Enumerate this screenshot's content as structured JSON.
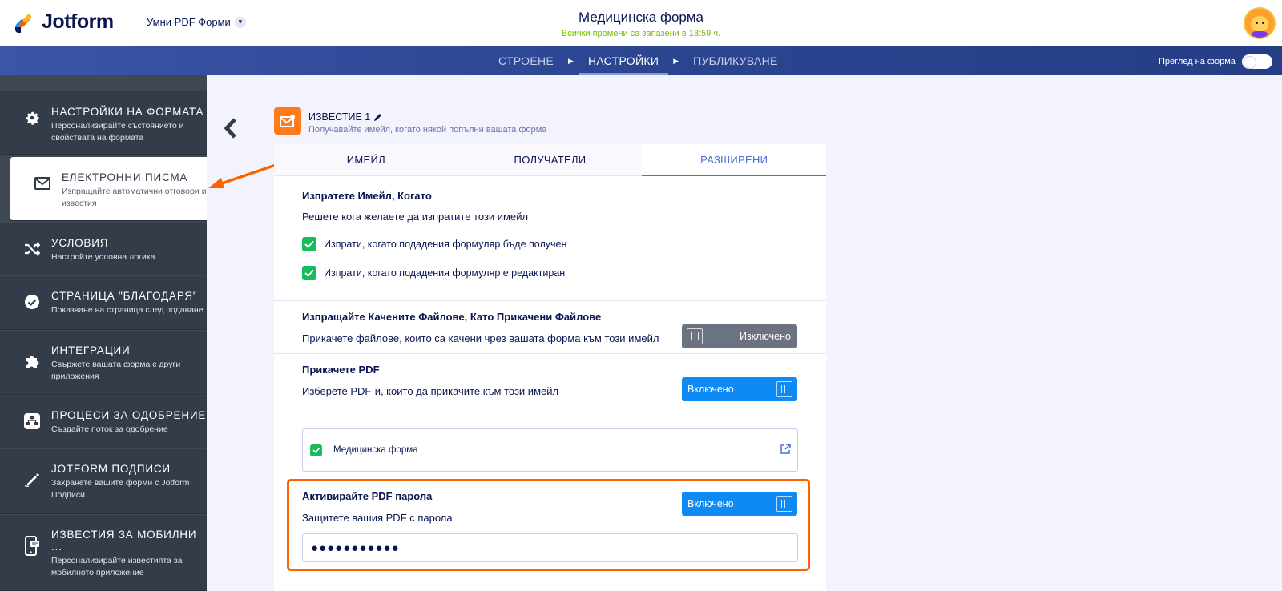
{
  "brand": {
    "name": "Jotform"
  },
  "header": {
    "form_switcher": "Умни PDF Форми",
    "form_title": "Медицинска форма",
    "save_status": "Всички промени са запазени в 13:59 ч."
  },
  "nav": {
    "tabs": [
      "СТРОЕНЕ",
      "НАСТРОЙКИ",
      "ПУБЛИКУВАНЕ"
    ],
    "active_tab": "НАСТРОЙКИ",
    "preview_label": "Преглед на форма"
  },
  "sidebar": {
    "items": [
      {
        "title": "НАСТРОЙКИ НА ФОРМАТА",
        "desc": "Персонализирайте състоянието и свойствата на формата",
        "icon": "gear-icon"
      },
      {
        "title": "ЕЛЕКТРОННИ ПИСМА",
        "desc": "Изпращайте автоматични отговори и известия",
        "icon": "envelope-icon",
        "active": true
      },
      {
        "title": "УСЛОВИЯ",
        "desc": "Настройте условна логика",
        "icon": "shuffle-icon"
      },
      {
        "title": "СТРАНИЦА \"БЛАГОДАРЯ\"",
        "desc": "Показване на страница след подаване",
        "icon": "check-circle-icon"
      },
      {
        "title": "ИНТЕГРАЦИИ",
        "desc": "Свържете вашата форма с други приложения",
        "icon": "puzzle-icon"
      },
      {
        "title": "ПРОЦЕСИ ЗА ОДОБРЕНИЕ",
        "desc": "Създайте поток за одобрение",
        "icon": "flow-icon"
      },
      {
        "title": "JOTFORM ПОДПИСИ",
        "desc": "Захранете вашите форми с Jotform Подписи",
        "icon": "pen-icon"
      },
      {
        "title": "ИЗВЕСТИЯ ЗА МОБИЛНИ ...",
        "desc": "Персонализирайте известията за мобилното приложение",
        "icon": "mobile-icon"
      }
    ]
  },
  "notification": {
    "title": "ИЗВЕСТИЕ 1",
    "subtitle": "Получавайте имейл, когато някой попълни вашата форма"
  },
  "tabs": [
    "ИМЕЙЛ",
    "ПОЛУЧАТЕЛИ",
    "РАЗШИРЕНИ"
  ],
  "active_tab": "РАЗШИРЕНИ",
  "send_when": {
    "title": "Изпратете Имейл, Когато",
    "desc": "Решете кога желаете да изпратите този имейл",
    "options": [
      "Изпрати, когато подадения формуляр бъде получен",
      "Изпрати, когато подадения формуляр е редактиран"
    ]
  },
  "attachments": {
    "title": "Изпращайте Качените Файлове, Като Прикачени Файлове",
    "desc": "Прикачете файлове, които са качени чрез вашата форма към този имейл",
    "state": "Изключено"
  },
  "attach_pdf": {
    "title": "Прикачете PDF",
    "desc": "Изберете PDF-и, които да прикачите към този имейл",
    "state": "Включено",
    "pdf_name": "Медицинска форма"
  },
  "pdf_password": {
    "title": "Активирайте PDF парола",
    "desc": "Защитете вашия PDF с парола.",
    "state": "Включено",
    "value": "●●●●●●●●●●●"
  },
  "colors": {
    "accent": "#4c6fd6",
    "toggle_on": "#0f8af5",
    "toggle_off": "#6b7280",
    "checkbox": "#18bd5b",
    "highlight": "#ff6100",
    "sidebar": "#343c49"
  }
}
